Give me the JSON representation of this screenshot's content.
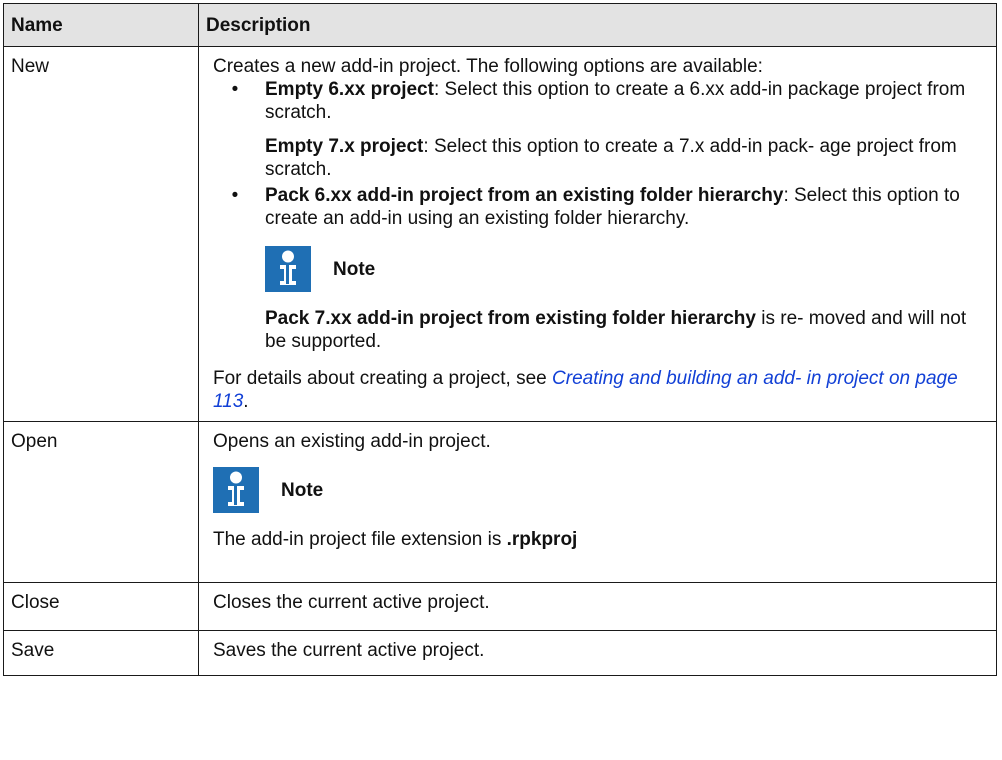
{
  "table": {
    "headers": {
      "name": "Name",
      "description": "Description"
    },
    "rows": {
      "new": {
        "name": "New",
        "intro": "Creates a new add-in project. The following options are available:",
        "option1": {
          "bold": "Empty 6.xx project",
          "text": ": Select this option to create a 6.xx add-in package project from scratch.",
          "sub_bold": "Empty 7.x project",
          "sub_text": ": Select this option to create a 7.x add-in pack- age project from scratch."
        },
        "option2": {
          "bold": "Pack 6.xx add-in project from an existing folder hierarchy",
          "text": ": Select this option to create an add-in using an existing folder hierarchy."
        },
        "note": {
          "label": "Note",
          "bold": "Pack 7.xx add-in project from existing folder hierarchy",
          "text": " is re- moved and will not be supported."
        },
        "details_prefix": "For details about creating a project, see ",
        "details_link": "Creating and building an add- in project on page 113",
        "details_suffix": "."
      },
      "open": {
        "name": "Open",
        "desc": "Opens an existing add-in project.",
        "note_label": "Note",
        "note_text": "The add-in project file extension is ",
        "note_bold": ".rpkproj"
      },
      "close": {
        "name": "Close",
        "desc": "Closes the current active project."
      },
      "save": {
        "name": "Save",
        "desc": "Saves the current active project."
      }
    }
  },
  "icons": {
    "note_icon": "info-icon",
    "note_icon_color": "#1f6fb4"
  }
}
